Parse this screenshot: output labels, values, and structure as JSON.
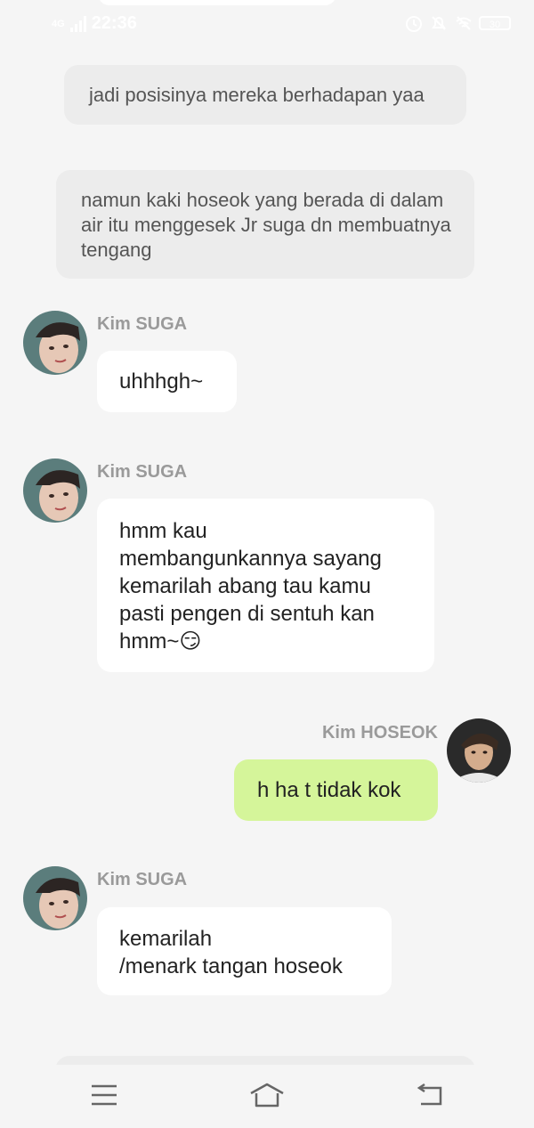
{
  "status_bar": {
    "network": "4G",
    "time": "22:36",
    "battery": "30"
  },
  "narrations": [
    {
      "text": "jadi posisinya mereka berhadapan yaa"
    },
    {
      "text": "namun kaki hoseok yang berada di dalam air itu  menggesek Jr suga dn membuatnya tengang"
    }
  ],
  "messages": [
    {
      "sender": "Kim SUGA",
      "side": "left",
      "text": "uhhhgh~"
    },
    {
      "sender": "Kim SUGA",
      "side": "left",
      "lines": [
        "hmm kau",
        "membangunkannya sayang",
        "kemarilah abang tau kamu",
        "pasti pengen di sentuh kan",
        "hmm~😏"
      ]
    },
    {
      "sender": "Kim HOSEOK",
      "side": "right",
      "text": "h ha t tidak kok"
    },
    {
      "sender": "Kim SUGA",
      "side": "left",
      "lines": [
        "kemarilah",
        "/menark tangan hoseok"
      ]
    }
  ],
  "colors": {
    "background": "#f5f5f5",
    "narration_bg": "#ececec",
    "bubble_left": "#ffffff",
    "bubble_right": "#d5f59a",
    "name_text": "#9a9a9a"
  },
  "nav": {
    "menu_icon": "menu-icon",
    "home_icon": "home-icon",
    "back_icon": "back-icon"
  }
}
